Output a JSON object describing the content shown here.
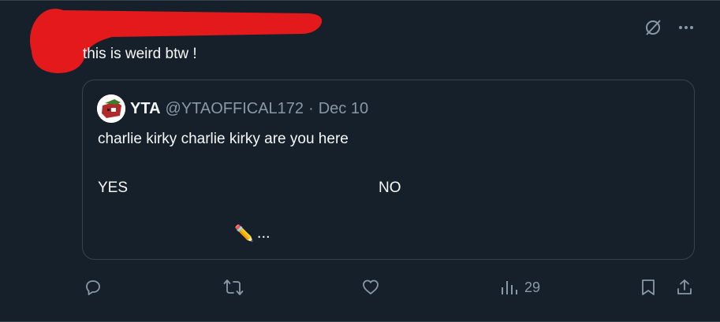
{
  "post": {
    "text": "this is weird btw !"
  },
  "top_actions": {
    "grok_icon": "slash-circle-icon",
    "more_icon": "more-dots-icon"
  },
  "quote": {
    "author_name": "YTA",
    "handle": "@YTAOFFICAL172",
    "separator": "·",
    "date": "Dec 10",
    "line1": "charlie kirky charlie kirky are you here",
    "option_yes": "YES",
    "option_no": "NO",
    "tail_emoji": "✏️",
    "tail_text": "..."
  },
  "actions": {
    "reply_icon": "reply-icon",
    "repost_icon": "repost-icon",
    "like_icon": "like-icon",
    "views_icon": "views-chart-icon",
    "views_count": "29",
    "bookmark_icon": "bookmark-icon",
    "share_icon": "share-icon"
  },
  "colors": {
    "background": "#15202b",
    "border": "#38444d",
    "text": "#f7f9f9",
    "muted": "#8b98a5",
    "redaction": "#e3191c"
  }
}
